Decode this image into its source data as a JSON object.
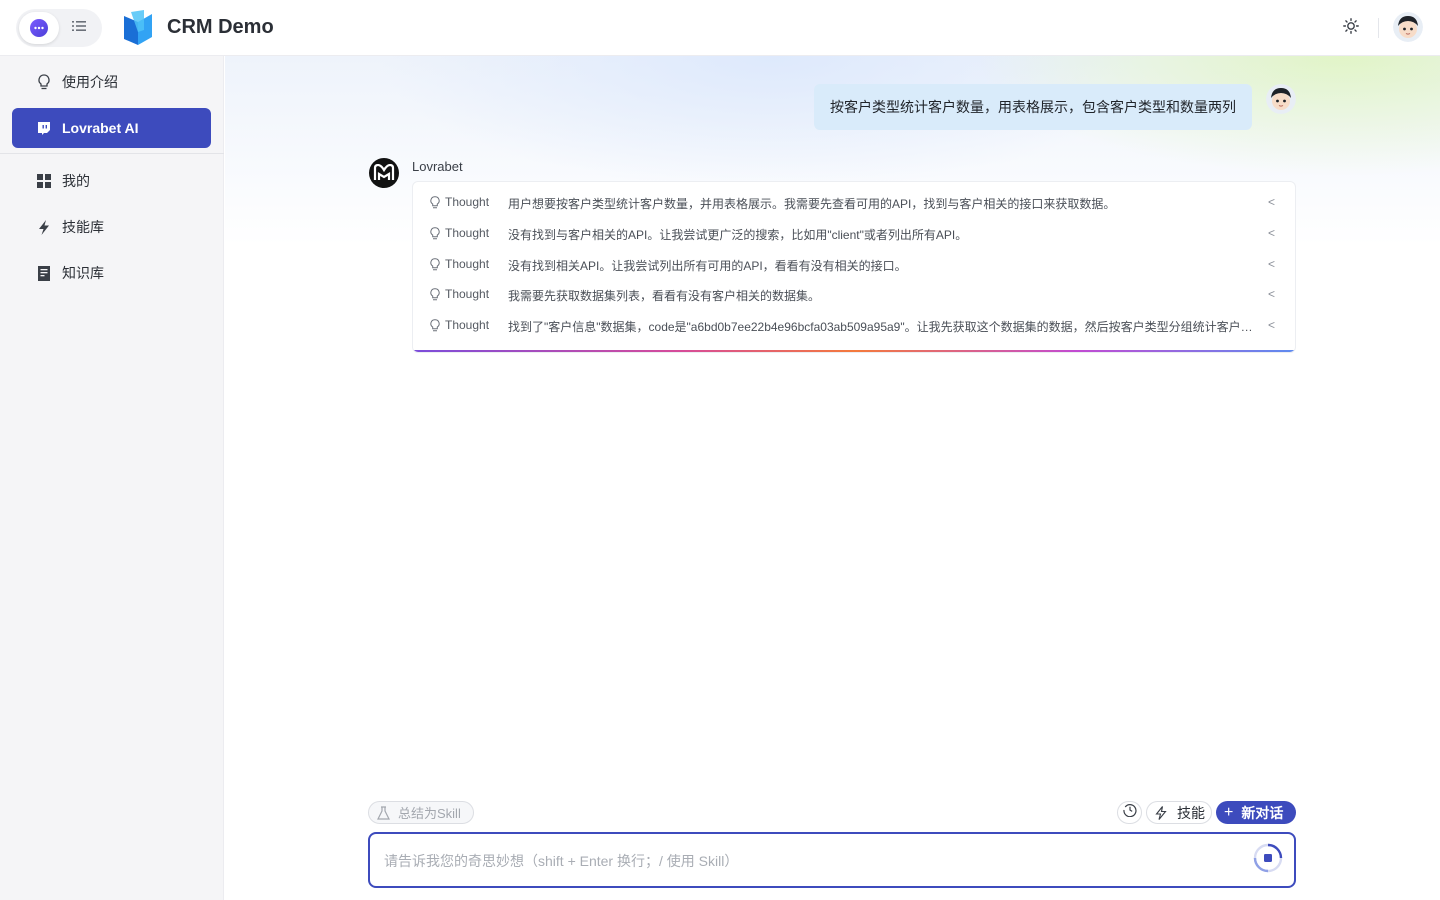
{
  "app": {
    "title": "CRM Demo"
  },
  "header": {
    "mode_icons": [
      "chat-icon",
      "list-icon"
    ],
    "theme_icon": "sun-icon",
    "avatar": "user-avatar"
  },
  "sidebar": {
    "items": [
      {
        "label": "使用介绍",
        "icon": "lightbulb-icon",
        "active": false
      },
      {
        "label": "Lovrabet AI",
        "icon": "twitch-chat-icon",
        "active": true
      },
      {
        "label": "我的",
        "icon": "grid-icon",
        "active": false
      },
      {
        "label": "技能库",
        "icon": "lightning-icon",
        "active": false
      },
      {
        "label": "知识库",
        "icon": "book-icon",
        "active": false
      }
    ]
  },
  "chat": {
    "user_message": "按客户类型统计客户数量，用表格展示，包含客户类型和数量两列",
    "bot_name": "Lovrabet",
    "thoughts": [
      {
        "label": "Thought",
        "text": "用户想要按客户类型统计客户数量，并用表格展示。我需要先查看可用的API，找到与客户相关的接口来获取数据。"
      },
      {
        "label": "Thought",
        "text": "没有找到与客户相关的API。让我尝试更广泛的搜索，比如用\"client\"或者列出所有API。"
      },
      {
        "label": "Thought",
        "text": "没有找到相关API。让我尝试列出所有可用的API，看看有没有相关的接口。"
      },
      {
        "label": "Thought",
        "text": "我需要先获取数据集列表，看看有没有客户相关的数据集。"
      },
      {
        "label": "Thought",
        "text": "找到了\"客户信息\"数据集，code是\"a6bd0b7ee22b4e96bcfa03ab509a95a9\"。让我先获取这个数据集的数据，然后按客户类型分组统计客户数量。"
      }
    ]
  },
  "composer": {
    "summarize_skill_label": "总结为Skill",
    "skills_label": "技能",
    "new_chat_label": "新对话",
    "placeholder": "请告诉我您的奇思妙想（shift + Enter 换行；/ 使用 Skill）",
    "value": ""
  },
  "colors": {
    "accent": "#3d4bbd",
    "user_bubble": "#d9ebfa",
    "sidebar_bg": "#f5f5f7"
  }
}
